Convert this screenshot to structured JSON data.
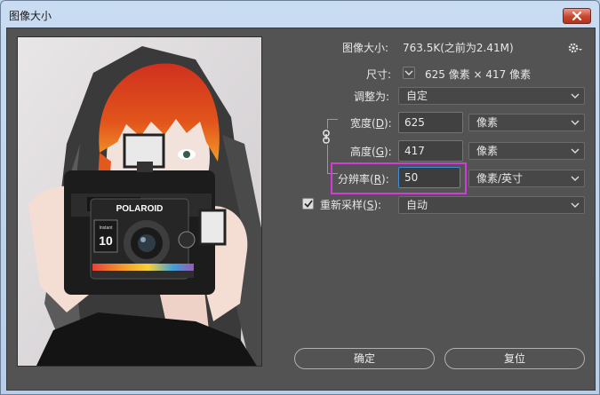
{
  "window": {
    "title": "图像大小"
  },
  "info": {
    "image_size_label": "图像大小:",
    "image_size_value": "763.5K(之前为2.41M)",
    "dimensions_label": "尺寸:",
    "dimensions_value": "625 像素 × 417 像素",
    "fit_to_label": "调整为:",
    "fit_to_value": "自定"
  },
  "fields": {
    "width": {
      "label": "宽度(",
      "hotkey": "D",
      "label_end": "):",
      "value": "625",
      "unit": "像素"
    },
    "height": {
      "label": "高度(",
      "hotkey": "G",
      "label_end": "):",
      "value": "417",
      "unit": "像素"
    },
    "resolution": {
      "label": "分辨率(",
      "hotkey": "R",
      "label_end": "):",
      "value": "50",
      "unit": "像素/英寸"
    }
  },
  "resample": {
    "label": "重新采样(",
    "hotkey": "S",
    "label_end": "):",
    "value": "自动",
    "checked": true
  },
  "buttons": {
    "ok": "确定",
    "reset": "复位"
  },
  "photo": {
    "camera_brand": "POLAROID",
    "camera_model": "Instant",
    "camera_number": "10"
  },
  "colors": {
    "highlight": "#d23cd6",
    "dialog_bg": "#535353",
    "focus": "#3f8fd6"
  },
  "icons": [
    "close-icon",
    "gear-icon",
    "link-icon",
    "chevron-down-icon",
    "checkmark-icon"
  ]
}
